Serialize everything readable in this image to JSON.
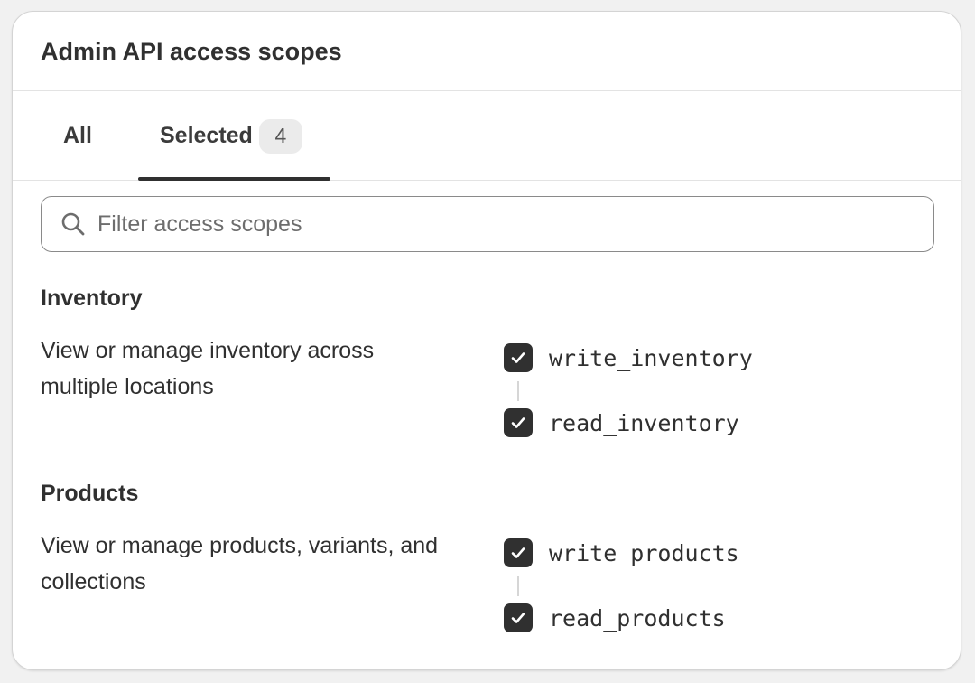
{
  "card": {
    "title": "Admin API access scopes"
  },
  "tabs": [
    {
      "label": "All",
      "active": false
    },
    {
      "label": "Selected",
      "badge": "4",
      "active": true
    }
  ],
  "search": {
    "placeholder": "Filter access scopes",
    "value": "",
    "icon": "search-icon"
  },
  "sections": [
    {
      "title": "Inventory",
      "description": "View or manage inventory across multiple locations",
      "scopes": [
        {
          "label": "write_inventory",
          "checked": true
        },
        {
          "label": "read_inventory",
          "checked": true
        }
      ]
    },
    {
      "title": "Products",
      "description": "View or manage products, variants, and collections",
      "scopes": [
        {
          "label": "write_products",
          "checked": true
        },
        {
          "label": "read_products",
          "checked": true
        }
      ]
    }
  ],
  "colors": {
    "checkbox_fill": "#303030",
    "text": "#303030",
    "tab_underline": "#303030",
    "badge_bg": "#ebebeb",
    "border": "#e3e3e3"
  }
}
